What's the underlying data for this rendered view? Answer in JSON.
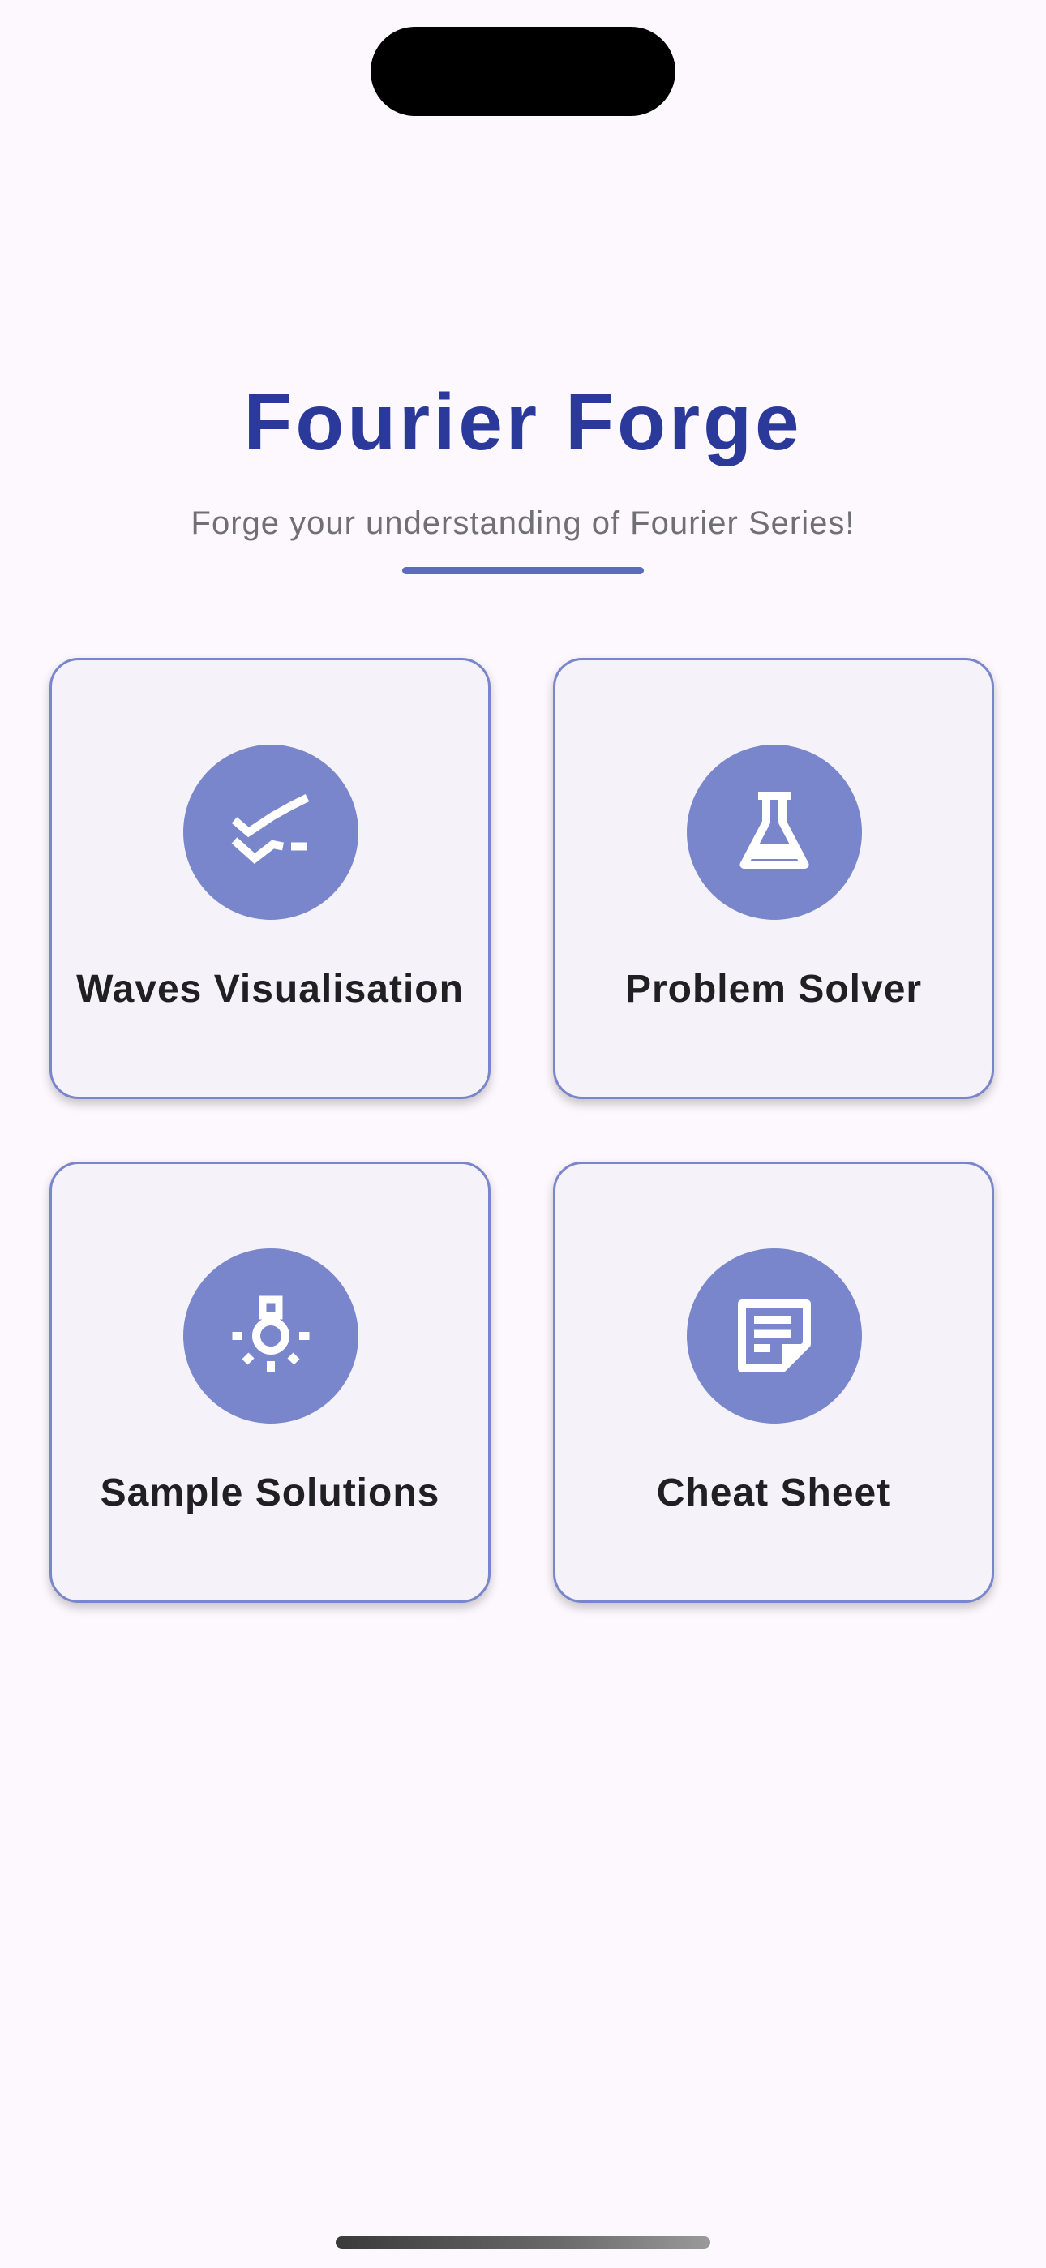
{
  "app": {
    "title": "Fourier Forge",
    "subtitle": "Forge your understanding of Fourier Series!"
  },
  "colors": {
    "background": "#fdf8fd",
    "title": "#2b3a9a",
    "accent": "#7986cb",
    "card_background": "#f5f3f9",
    "card_border": "#7986cb"
  },
  "cards": [
    {
      "label": "Waves Visualisation",
      "icon": "waves-icon"
    },
    {
      "label": "Problem Solver",
      "icon": "science-flask-icon"
    },
    {
      "label": "Sample Solutions",
      "icon": "lightbulb-icon"
    },
    {
      "label": "Cheat Sheet",
      "icon": "sticky-note-icon"
    }
  ]
}
